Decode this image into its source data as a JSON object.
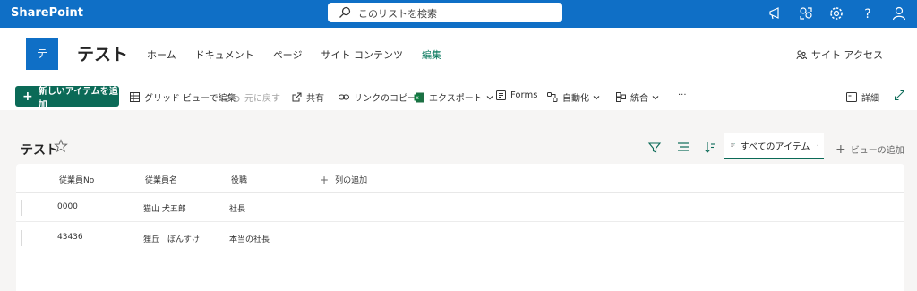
{
  "suite": {
    "brand": "SharePoint",
    "search_placeholder": "このリストを検索",
    "accent_color": "#0f6fc6"
  },
  "site": {
    "logo_letter": "テ",
    "title": "テスト",
    "nav": [
      "ホーム",
      "ドキュメント",
      "ページ",
      "サイト コンテンツ",
      "編集"
    ],
    "access_label": "サイト アクセス"
  },
  "commands": {
    "new_item": "新しいアイテムを追加",
    "grid_edit": "グリッド ビューで編集",
    "undo": "元に戻す",
    "share": "共有",
    "copy_link": "リンクのコピー",
    "export": "エクスポート",
    "forms": "Forms",
    "automate": "自動化",
    "integrate": "統合",
    "more": "···",
    "details": "詳細",
    "brand_green": "#0b6a57"
  },
  "list": {
    "title": "テスト",
    "view_name": "すべてのアイテム",
    "add_view": "ビューの追加",
    "columns": [
      "従業員No",
      "従業員名",
      "役職"
    ],
    "add_column": "列の追加",
    "rows": [
      {
        "no": "0000",
        "name": "猫山 犬五郎",
        "role": "社長"
      },
      {
        "no": "43436",
        "name": "狸丘　ぽんすけ",
        "role": "本当の社長"
      }
    ]
  }
}
